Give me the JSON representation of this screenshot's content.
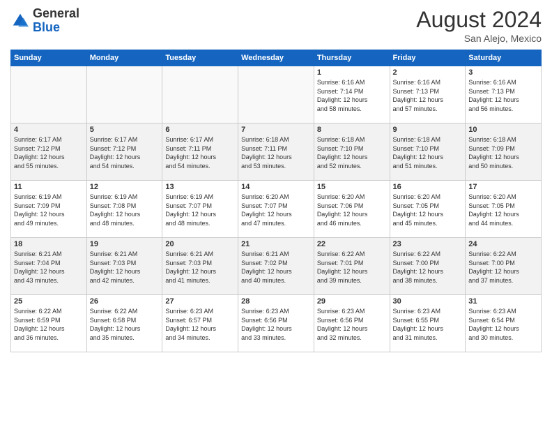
{
  "logo": {
    "general": "General",
    "blue": "Blue"
  },
  "title": {
    "month_year": "August 2024",
    "location": "San Alejo, Mexico"
  },
  "days_of_week": [
    "Sunday",
    "Monday",
    "Tuesday",
    "Wednesday",
    "Thursday",
    "Friday",
    "Saturday"
  ],
  "weeks": [
    [
      {
        "day": "",
        "info": ""
      },
      {
        "day": "",
        "info": ""
      },
      {
        "day": "",
        "info": ""
      },
      {
        "day": "",
        "info": ""
      },
      {
        "day": "1",
        "info": "Sunrise: 6:16 AM\nSunset: 7:14 PM\nDaylight: 12 hours\nand 58 minutes."
      },
      {
        "day": "2",
        "info": "Sunrise: 6:16 AM\nSunset: 7:13 PM\nDaylight: 12 hours\nand 57 minutes."
      },
      {
        "day": "3",
        "info": "Sunrise: 6:16 AM\nSunset: 7:13 PM\nDaylight: 12 hours\nand 56 minutes."
      }
    ],
    [
      {
        "day": "4",
        "info": "Sunrise: 6:17 AM\nSunset: 7:12 PM\nDaylight: 12 hours\nand 55 minutes."
      },
      {
        "day": "5",
        "info": "Sunrise: 6:17 AM\nSunset: 7:12 PM\nDaylight: 12 hours\nand 54 minutes."
      },
      {
        "day": "6",
        "info": "Sunrise: 6:17 AM\nSunset: 7:11 PM\nDaylight: 12 hours\nand 54 minutes."
      },
      {
        "day": "7",
        "info": "Sunrise: 6:18 AM\nSunset: 7:11 PM\nDaylight: 12 hours\nand 53 minutes."
      },
      {
        "day": "8",
        "info": "Sunrise: 6:18 AM\nSunset: 7:10 PM\nDaylight: 12 hours\nand 52 minutes."
      },
      {
        "day": "9",
        "info": "Sunrise: 6:18 AM\nSunset: 7:10 PM\nDaylight: 12 hours\nand 51 minutes."
      },
      {
        "day": "10",
        "info": "Sunrise: 6:18 AM\nSunset: 7:09 PM\nDaylight: 12 hours\nand 50 minutes."
      }
    ],
    [
      {
        "day": "11",
        "info": "Sunrise: 6:19 AM\nSunset: 7:09 PM\nDaylight: 12 hours\nand 49 minutes."
      },
      {
        "day": "12",
        "info": "Sunrise: 6:19 AM\nSunset: 7:08 PM\nDaylight: 12 hours\nand 48 minutes."
      },
      {
        "day": "13",
        "info": "Sunrise: 6:19 AM\nSunset: 7:07 PM\nDaylight: 12 hours\nand 48 minutes."
      },
      {
        "day": "14",
        "info": "Sunrise: 6:20 AM\nSunset: 7:07 PM\nDaylight: 12 hours\nand 47 minutes."
      },
      {
        "day": "15",
        "info": "Sunrise: 6:20 AM\nSunset: 7:06 PM\nDaylight: 12 hours\nand 46 minutes."
      },
      {
        "day": "16",
        "info": "Sunrise: 6:20 AM\nSunset: 7:05 PM\nDaylight: 12 hours\nand 45 minutes."
      },
      {
        "day": "17",
        "info": "Sunrise: 6:20 AM\nSunset: 7:05 PM\nDaylight: 12 hours\nand 44 minutes."
      }
    ],
    [
      {
        "day": "18",
        "info": "Sunrise: 6:21 AM\nSunset: 7:04 PM\nDaylight: 12 hours\nand 43 minutes."
      },
      {
        "day": "19",
        "info": "Sunrise: 6:21 AM\nSunset: 7:03 PM\nDaylight: 12 hours\nand 42 minutes."
      },
      {
        "day": "20",
        "info": "Sunrise: 6:21 AM\nSunset: 7:03 PM\nDaylight: 12 hours\nand 41 minutes."
      },
      {
        "day": "21",
        "info": "Sunrise: 6:21 AM\nSunset: 7:02 PM\nDaylight: 12 hours\nand 40 minutes."
      },
      {
        "day": "22",
        "info": "Sunrise: 6:22 AM\nSunset: 7:01 PM\nDaylight: 12 hours\nand 39 minutes."
      },
      {
        "day": "23",
        "info": "Sunrise: 6:22 AM\nSunset: 7:00 PM\nDaylight: 12 hours\nand 38 minutes."
      },
      {
        "day": "24",
        "info": "Sunrise: 6:22 AM\nSunset: 7:00 PM\nDaylight: 12 hours\nand 37 minutes."
      }
    ],
    [
      {
        "day": "25",
        "info": "Sunrise: 6:22 AM\nSunset: 6:59 PM\nDaylight: 12 hours\nand 36 minutes."
      },
      {
        "day": "26",
        "info": "Sunrise: 6:22 AM\nSunset: 6:58 PM\nDaylight: 12 hours\nand 35 minutes."
      },
      {
        "day": "27",
        "info": "Sunrise: 6:23 AM\nSunset: 6:57 PM\nDaylight: 12 hours\nand 34 minutes."
      },
      {
        "day": "28",
        "info": "Sunrise: 6:23 AM\nSunset: 6:56 PM\nDaylight: 12 hours\nand 33 minutes."
      },
      {
        "day": "29",
        "info": "Sunrise: 6:23 AM\nSunset: 6:56 PM\nDaylight: 12 hours\nand 32 minutes."
      },
      {
        "day": "30",
        "info": "Sunrise: 6:23 AM\nSunset: 6:55 PM\nDaylight: 12 hours\nand 31 minutes."
      },
      {
        "day": "31",
        "info": "Sunrise: 6:23 AM\nSunset: 6:54 PM\nDaylight: 12 hours\nand 30 minutes."
      }
    ]
  ]
}
